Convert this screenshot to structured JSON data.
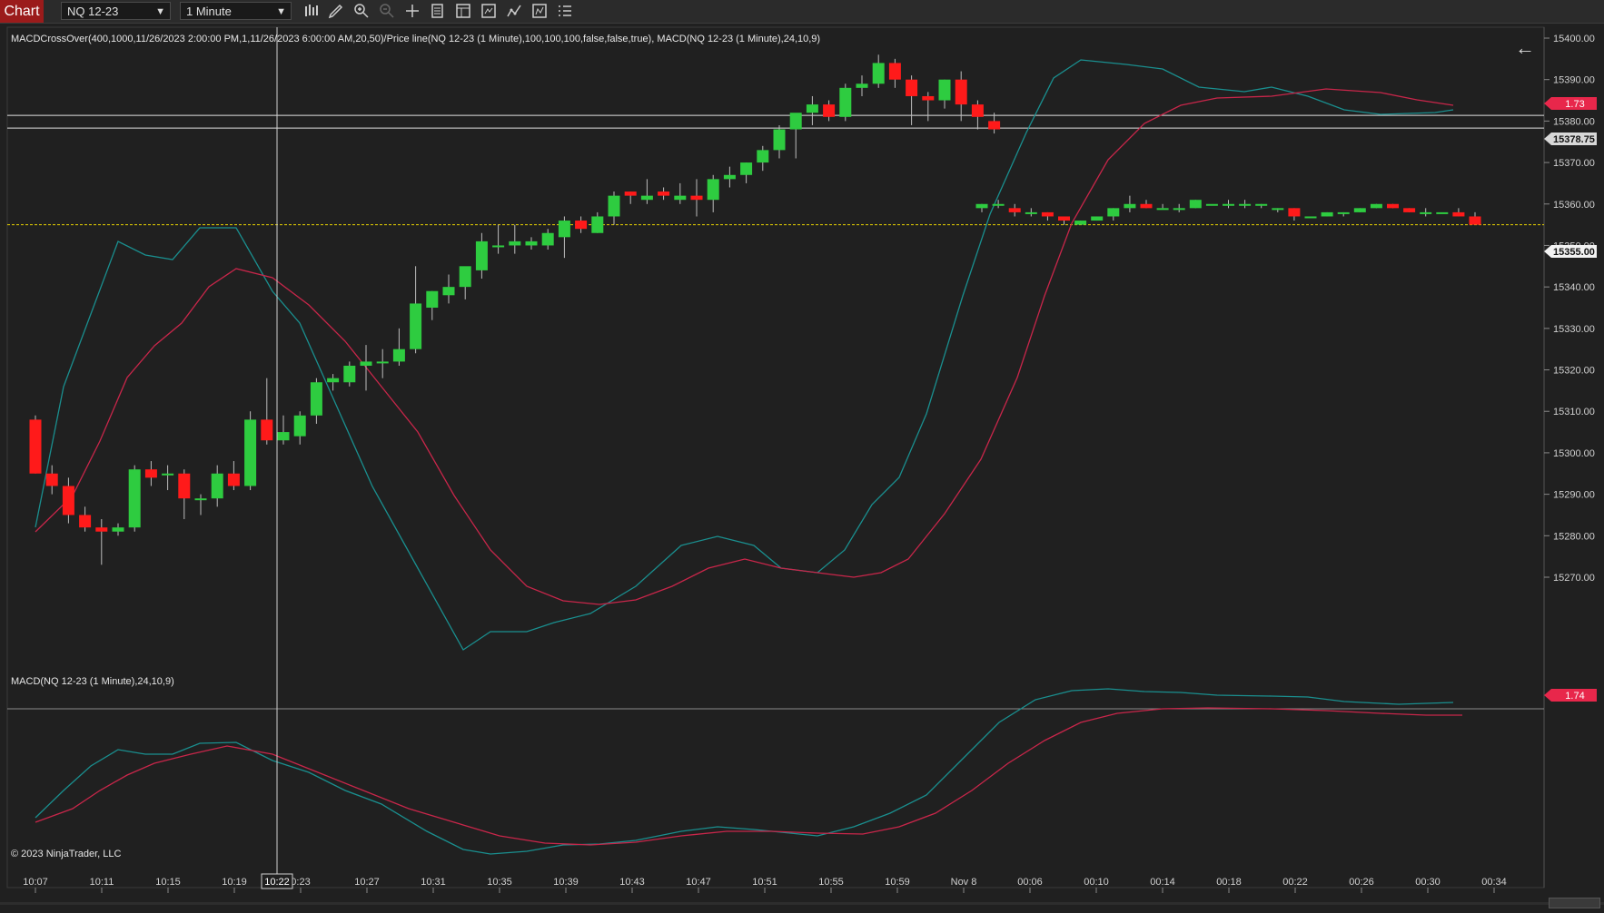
{
  "toolbar": {
    "chart_tab": "Chart",
    "instrument": "NQ 12-23",
    "interval": "1 Minute",
    "tools": [
      "bar-type-icon",
      "draw-pencil-icon",
      "zoom-in-icon",
      "zoom-out-icon",
      "crosshair-icon",
      "data-series-icon",
      "templates-icon",
      "properties-icon",
      "strategies-icon",
      "indicators-icon",
      "more-icon"
    ]
  },
  "main_panel": {
    "indicator_label": "MACDCrossOver(400,1000,11/26/2023 2:00:00 PM,1,11/26/2023 6:00:00 AM,20,50)/Price line(NQ 12-23 (1 Minute),100,100,100,false,false,true), MACD(NQ 12-23 (1 Minute),24,10,9)",
    "back_arrow": "←",
    "y_ticks": [
      "15400.00",
      "15390.00",
      "15380.00",
      "15370.00",
      "15360.00",
      "15350.00",
      "15340.00",
      "15330.00",
      "15320.00",
      "15310.00",
      "15300.00",
      "15290.00",
      "15280.00",
      "15270.00"
    ],
    "macd_badge": "1.73",
    "price_line_badge": "15378.75",
    "last_price_badge": "15355.00",
    "colors": {
      "up": "#2ecc40",
      "down": "#ff1a1a",
      "macd": "#1a8f8f",
      "signal": "#c8264a",
      "badge": "#e8274b"
    }
  },
  "macd_panel": {
    "label": "MACD(NQ 12-23 (1 Minute),24,10,9)",
    "badge": "1.74",
    "copyright": "© 2023 NinjaTrader, LLC"
  },
  "x_axis": {
    "ticks": [
      "10:07",
      "10:11",
      "10:15",
      "10:19",
      "0:23",
      "10:27",
      "10:31",
      "10:35",
      "10:39",
      "10:43",
      "10:47",
      "10:51",
      "10:55",
      "10:59",
      "Nov 8",
      "00:06",
      "00:10",
      "00:14",
      "00:18",
      "00:22",
      "00:26",
      "00:30",
      "00:34"
    ],
    "crosshair_time": "10:22"
  },
  "chart_data": {
    "type": "candlestick",
    "instrument": "NQ 12-23",
    "interval": "1 Minute",
    "ylim": [
      15265,
      15405
    ],
    "candles_session1": [
      {
        "o": 15308,
        "h": 15309,
        "l": 15295,
        "c": 15295
      },
      {
        "o": 15295,
        "h": 15297,
        "l": 15290,
        "c": 15292
      },
      {
        "o": 15292,
        "h": 15294,
        "l": 15283,
        "c": 15285
      },
      {
        "o": 15285,
        "h": 15287,
        "l": 15281,
        "c": 15282
      },
      {
        "o": 15282,
        "h": 15284,
        "l": 15273,
        "c": 15281
      },
      {
        "o": 15281,
        "h": 15283,
        "l": 15280,
        "c": 15282
      },
      {
        "o": 15282,
        "h": 15297,
        "l": 15281,
        "c": 15296
      },
      {
        "o": 15296,
        "h": 15298,
        "l": 15292,
        "c": 15294
      },
      {
        "o": 15295,
        "h": 15297,
        "l": 15291,
        "c": 15295
      },
      {
        "o": 15295,
        "h": 15296,
        "l": 15284,
        "c": 15289
      },
      {
        "o": 15289,
        "h": 15290,
        "l": 15285,
        "c": 15289
      },
      {
        "o": 15289,
        "h": 15297,
        "l": 15287,
        "c": 15295
      },
      {
        "o": 15295,
        "h": 15298,
        "l": 15291,
        "c": 15292
      },
      {
        "o": 15292,
        "h": 15310,
        "l": 15291,
        "c": 15308
      },
      {
        "o": 15308,
        "h": 15318,
        "l": 15302,
        "c": 15303
      },
      {
        "o": 15303,
        "h": 15309,
        "l": 15302,
        "c": 15305
      },
      {
        "o": 15304,
        "h": 15310,
        "l": 15302,
        "c": 15309
      },
      {
        "o": 15309,
        "h": 15318,
        "l": 15307,
        "c": 15317
      },
      {
        "o": 15317,
        "h": 15319,
        "l": 15315,
        "c": 15318
      },
      {
        "o": 15317,
        "h": 15322,
        "l": 15316,
        "c": 15321
      },
      {
        "o": 15321,
        "h": 15326,
        "l": 15315,
        "c": 15322
      },
      {
        "o": 15322,
        "h": 15325,
        "l": 15318,
        "c": 15322
      },
      {
        "o": 15322,
        "h": 15330,
        "l": 15321,
        "c": 15325
      },
      {
        "o": 15325,
        "h": 15345,
        "l": 15324,
        "c": 15336
      },
      {
        "o": 15335,
        "h": 15339,
        "l": 15332,
        "c": 15339
      },
      {
        "o": 15338,
        "h": 15343,
        "l": 15336,
        "c": 15340
      },
      {
        "o": 15340,
        "h": 15343,
        "l": 15337,
        "c": 15345
      },
      {
        "o": 15344,
        "h": 15353,
        "l": 15342,
        "c": 15351
      },
      {
        "o": 15350,
        "h": 15355,
        "l": 15348,
        "c": 15350
      },
      {
        "o": 15350,
        "h": 15355,
        "l": 15348,
        "c": 15351
      },
      {
        "o": 15350,
        "h": 15352,
        "l": 15349,
        "c": 15351
      },
      {
        "o": 15350,
        "h": 15354,
        "l": 15349,
        "c": 15353
      },
      {
        "o": 15352,
        "h": 15357,
        "l": 15347,
        "c": 15356
      },
      {
        "o": 15356,
        "h": 15357,
        "l": 15353,
        "c": 15354
      },
      {
        "o": 15353,
        "h": 15358,
        "l": 15353,
        "c": 15357
      },
      {
        "o": 15357,
        "h": 15363,
        "l": 15355,
        "c": 15362
      },
      {
        "o": 15363,
        "h": 15363,
        "l": 15360,
        "c": 15362
      },
      {
        "o": 15361,
        "h": 15366,
        "l": 15360,
        "c": 15362
      },
      {
        "o": 15363,
        "h": 15364,
        "l": 15361,
        "c": 15362
      },
      {
        "o": 15361,
        "h": 15365,
        "l": 15360,
        "c": 15362
      },
      {
        "o": 15362,
        "h": 15366,
        "l": 15357,
        "c": 15361
      },
      {
        "o": 15361,
        "h": 15367,
        "l": 15358,
        "c": 15366
      },
      {
        "o": 15366,
        "h": 15369,
        "l": 15364,
        "c": 15367
      },
      {
        "o": 15367,
        "h": 15370,
        "l": 15365,
        "c": 15370
      },
      {
        "o": 15370,
        "h": 15374,
        "l": 15368,
        "c": 15373
      },
      {
        "o": 15373,
        "h": 15379,
        "l": 15371,
        "c": 15378
      },
      {
        "o": 15378,
        "h": 15380,
        "l": 15371,
        "c": 15382
      },
      {
        "o": 15382,
        "h": 15386,
        "l": 15379,
        "c": 15384
      },
      {
        "o": 15384,
        "h": 15385,
        "l": 15380,
        "c": 15381
      },
      {
        "o": 15381,
        "h": 15389,
        "l": 15380,
        "c": 15388
      },
      {
        "o": 15388,
        "h": 15391,
        "l": 15386,
        "c": 15389
      },
      {
        "o": 15389,
        "h": 15396,
        "l": 15388,
        "c": 15394
      },
      {
        "o": 15394,
        "h": 15395,
        "l": 15388,
        "c": 15390
      },
      {
        "o": 15390,
        "h": 15391,
        "l": 15379,
        "c": 15386
      },
      {
        "o": 15386,
        "h": 15387,
        "l": 15380,
        "c": 15385
      },
      {
        "o": 15385,
        "h": 15390,
        "l": 15383,
        "c": 15390
      },
      {
        "o": 15390,
        "h": 15392,
        "l": 15380,
        "c": 15384
      },
      {
        "o": 15384,
        "h": 15385,
        "l": 15378,
        "c": 15381
      },
      {
        "o": 15380,
        "h": 15382,
        "l": 15377,
        "c": 15378
      }
    ],
    "candles_session2": [
      {
        "o": 15359,
        "h": 15360,
        "l": 15358,
        "c": 15360
      },
      {
        "o": 15360,
        "h": 15361,
        "l": 15359,
        "c": 15360
      },
      {
        "o": 15359,
        "h": 15360,
        "l": 15357,
        "c": 15358
      },
      {
        "o": 15358,
        "h": 15359,
        "l": 15357,
        "c": 15358
      },
      {
        "o": 15358,
        "h": 15358,
        "l": 15356,
        "c": 15357
      },
      {
        "o": 15357,
        "h": 15357,
        "l": 15355,
        "c": 15356
      },
      {
        "o": 15355,
        "h": 15356,
        "l": 15355,
        "c": 15356
      },
      {
        "o": 15356,
        "h": 15357,
        "l": 15356,
        "c": 15357
      },
      {
        "o": 15357,
        "h": 15359,
        "l": 15356,
        "c": 15359
      },
      {
        "o": 15359,
        "h": 15362,
        "l": 15358,
        "c": 15360
      },
      {
        "o": 15360,
        "h": 15361,
        "l": 15359,
        "c": 15359
      },
      {
        "o": 15359,
        "h": 15360,
        "l": 15359,
        "c": 15359
      },
      {
        "o": 15359,
        "h": 15360,
        "l": 15358,
        "c": 15359
      },
      {
        "o": 15359,
        "h": 15361,
        "l": 15359,
        "c": 15361
      },
      {
        "o": 15360,
        "h": 15360,
        "l": 15360,
        "c": 15360
      },
      {
        "o": 15360,
        "h": 15361,
        "l": 15359,
        "c": 15360
      },
      {
        "o": 15360,
        "h": 15361,
        "l": 15359,
        "c": 15360
      },
      {
        "o": 15360,
        "h": 15360,
        "l": 15359,
        "c": 15360
      },
      {
        "o": 15359,
        "h": 15359,
        "l": 15358,
        "c": 15359
      },
      {
        "o": 15359,
        "h": 15359,
        "l": 15356,
        "c": 15357
      },
      {
        "o": 15357,
        "h": 15357,
        "l": 15357,
        "c": 15357
      },
      {
        "o": 15357,
        "h": 15358,
        "l": 15357,
        "c": 15358
      },
      {
        "o": 15358,
        "h": 15358,
        "l": 15357,
        "c": 15358
      },
      {
        "o": 15358,
        "h": 15359,
        "l": 15358,
        "c": 15359
      },
      {
        "o": 15359,
        "h": 15360,
        "l": 15359,
        "c": 15360
      },
      {
        "o": 15360,
        "h": 15360,
        "l": 15359,
        "c": 15359
      },
      {
        "o": 15359,
        "h": 15359,
        "l": 15358,
        "c": 15358
      },
      {
        "o": 15358,
        "h": 15359,
        "l": 15357,
        "c": 15358
      },
      {
        "o": 15358,
        "h": 15358,
        "l": 15358,
        "c": 15358
      },
      {
        "o": 15358,
        "h": 15359,
        "l": 15357,
        "c": 15357
      },
      {
        "o": 15357,
        "h": 15358,
        "l": 15355,
        "c": 15355
      }
    ],
    "price_line": 15378.75,
    "last_price": 15355.0
  }
}
